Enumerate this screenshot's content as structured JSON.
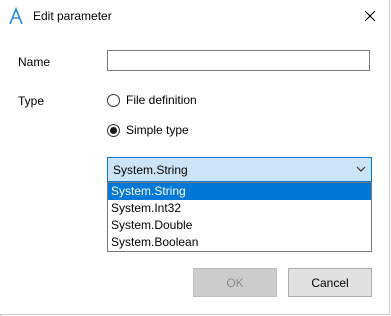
{
  "window": {
    "title": "Edit parameter",
    "close_symbol": "✕",
    "app_icon": "app-logo-icon"
  },
  "form": {
    "name_label": "Name",
    "name_value": "",
    "type_label": "Type",
    "radio_file_definition": "File definition",
    "radio_simple_type": "Simple type",
    "selected_radio": "Simple type"
  },
  "combo": {
    "selected_value": "System.String",
    "options": [
      "System.String",
      "System.Int32",
      "System.Double",
      "System.Boolean"
    ],
    "arrow_icon": "chevron-down-icon"
  },
  "buttons": {
    "ok_label": "OK",
    "cancel_label": "Cancel",
    "ok_enabled": false
  },
  "colors": {
    "accent": "#0078d7",
    "combo_bg": "#cce4f7",
    "ok_disabled_bg": "#cccccc",
    "button_bg": "#e1e1e1"
  }
}
